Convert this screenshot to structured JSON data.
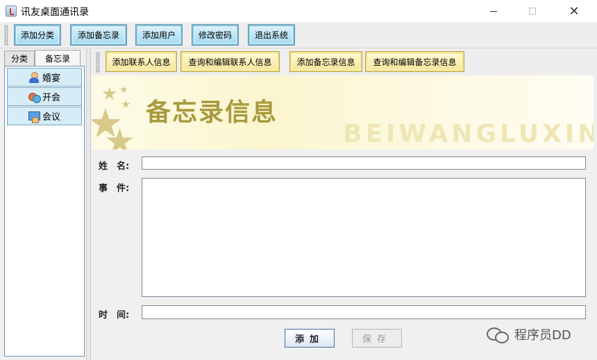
{
  "window": {
    "title": "讯友桌面通讯录",
    "icon": "java-cup-icon",
    "controls": {
      "minimize": "minimize-icon",
      "maximize": "maximize-icon",
      "close": "✕"
    }
  },
  "toolbar": {
    "buttons": [
      {
        "label": "添加分类"
      },
      {
        "label": "添加备忘录"
      },
      {
        "label": "添加用户"
      },
      {
        "label": "修改密码"
      },
      {
        "label": "退出系统"
      }
    ],
    "accent": "#7ec4e4"
  },
  "left_panel": {
    "tabs": [
      {
        "label": "分类",
        "active": false
      },
      {
        "label": "备忘录",
        "active": true
      }
    ],
    "items": [
      {
        "label": "婚宴",
        "icon": "person-icon"
      },
      {
        "label": "开会",
        "icon": "group-icon"
      },
      {
        "label": "会议",
        "icon": "meeting-icon"
      }
    ]
  },
  "sub_toolbar": {
    "buttons": [
      {
        "label": "添加联系人信息"
      },
      {
        "label": "查询和编辑联系人信息"
      },
      {
        "label": "添加备忘录信息"
      },
      {
        "label": "查询和编辑备忘录信息"
      }
    ],
    "accent": "#f2e28a"
  },
  "banner": {
    "title": "备忘录信息",
    "subtitle": "BEIWANGLUXINXI"
  },
  "form": {
    "name_label": "姓　名:",
    "name_value": "",
    "event_label": "事　件:",
    "event_value": "",
    "time_label": "时　间:",
    "time_value": "",
    "add_button": "添加",
    "save_button": "保存"
  },
  "watermark": {
    "text": "程序员DD",
    "icon": "wechat-icon"
  }
}
